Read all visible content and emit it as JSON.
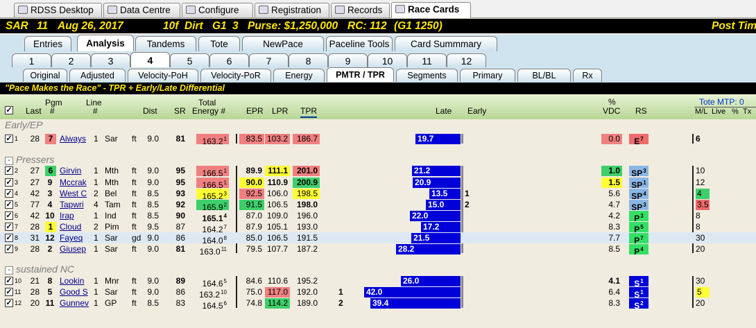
{
  "window_tabs": [
    {
      "label": "RDSS Desktop",
      "icon": "horse-icon"
    },
    {
      "label": "Data Centre",
      "icon": "table-icon"
    },
    {
      "label": "Configure",
      "icon": "gear-icon"
    },
    {
      "label": "Registration",
      "icon": "tools-icon"
    },
    {
      "label": "Records",
      "icon": "grid-icon"
    },
    {
      "label": "Race Cards",
      "icon": "document-icon",
      "active": true
    }
  ],
  "race_header": {
    "track": "SAR",
    "race": "11",
    "date": "Aug 26, 2017",
    "distance": "10f",
    "surface": "Dirt",
    "grade": "G1",
    "field": "3",
    "purse": "Purse: $1,250,000",
    "rc": "RC: 112",
    "rc_grade": "(G1 1250)",
    "post_time": "Post Tim"
  },
  "main_tabs": [
    "Entries",
    "Analysis",
    "Tandems",
    "Tote",
    "NewPace",
    "Paceline Tools",
    "Card Summmary"
  ],
  "main_tabs_active": 1,
  "race_tabs": [
    "1",
    "2",
    "3",
    "4",
    "5",
    "6",
    "7",
    "8",
    "9",
    "10",
    "11",
    "12"
  ],
  "race_tabs_active": 3,
  "sub_tabs": [
    "Original",
    "Adjusted",
    "Velocity-PoH",
    "Velocity-PoR",
    "Energy",
    "PMTR / TPR",
    "Segments",
    "Primary",
    "BL/BL",
    "Rx"
  ],
  "sub_tabs_active": 5,
  "banner": "\"Pace Makes the Race\" - TPR + Early/Late Differential",
  "columns": {
    "last": "Last",
    "pgm": "Pgm",
    "pgm2": "#",
    "line": "Line",
    "line2": "#",
    "dist": "Dist",
    "sr": "SR",
    "total": "Total",
    "energy": "Energy #",
    "epr": "EPR",
    "lpr": "LPR",
    "tpr": "TPR",
    "late": "Late",
    "early": "Early",
    "pct": "%",
    "vdc": "VDC",
    "rs": "RS",
    "tote": "Tote MTP: 0",
    "ml": "M/L",
    "live": "Live",
    "pct2": "%",
    "tx": "Tx"
  },
  "groups": [
    {
      "label": "Early/EP",
      "collapsible": false
    },
    {
      "label": "Pressers",
      "collapsible": true
    },
    {
      "label": "sustained NC",
      "collapsible": true
    }
  ],
  "rows": [
    {
      "idx": "1",
      "last": "28",
      "pgm": "7",
      "name": "Always",
      "line": "1",
      "trk": "Sar",
      "sfc": "ft",
      "dist": "9.0",
      "sr": "81",
      "energy": "163.2",
      "erank": "1",
      "epr": "83.5",
      "lpr": "103.2",
      "tpr": "186.7",
      "late": "19.7",
      "early": "",
      "vdc": "0.0",
      "rs": "E",
      "rsn": "7",
      "ml": "6",
      "mlbold": true
    },
    {
      "idx": "2",
      "last": "27",
      "pgm": "6",
      "name": "Girvin",
      "line": "1",
      "trk": "Mth",
      "sfc": "ft",
      "dist": "9.0",
      "sr": "95",
      "energy": "166.5",
      "erank": "1",
      "epr": "89.9",
      "lpr": "111.1",
      "tpr": "201.0",
      "late": "21.2",
      "early": "",
      "vdc": "1.0",
      "rs": "SP",
      "rsn": "3",
      "ml": "10"
    },
    {
      "idx": "3",
      "last": "27",
      "pgm": "9",
      "name": "Mccrak",
      "line": "1",
      "trk": "Mth",
      "sfc": "ft",
      "dist": "9.0",
      "sr": "95",
      "energy": "166.5",
      "erank": "1",
      "epr": "90.0",
      "lpr": "110.9",
      "tpr": "200.9",
      "late": "20.9",
      "early": "",
      "vdc": "1.5",
      "rs": "SP",
      "rsn": "1",
      "ml": "12"
    },
    {
      "idx": "4",
      "last": "42",
      "pgm": "3",
      "name": "West C",
      "line": "2",
      "trk": "Bel",
      "sfc": "ft",
      "dist": "8.5",
      "sr": "93",
      "energy": "165.2",
      "erank": "3",
      "epr": "92.5",
      "lpr": "106.0",
      "tpr": "198.5",
      "late": "13.5",
      "early": "1",
      "vdc": "5.6",
      "rs": "SP",
      "rsn": "4",
      "ml": "4"
    },
    {
      "idx": "5",
      "last": "77",
      "pgm": "4",
      "name": "Tapwri",
      "line": "4",
      "trk": "Tam",
      "sfc": "ft",
      "dist": "8.5",
      "sr": "92",
      "energy": "165.9",
      "erank": "2",
      "epr": "91.5",
      "lpr": "106.5",
      "tpr": "198.0",
      "late": "15.0",
      "early": "2",
      "vdc": "4.7",
      "rs": "SP",
      "rsn": "3",
      "ml": "3.5"
    },
    {
      "idx": "6",
      "last": "42",
      "pgm": "10",
      "name": "Irap",
      "line": "1",
      "trk": "Ind",
      "sfc": "ft",
      "dist": "8.5",
      "sr": "90",
      "energy": "165.1",
      "erank": "4",
      "epr": "87.0",
      "lpr": "109.0",
      "tpr": "196.0",
      "late": "22.0",
      "early": "",
      "vdc": "4.2",
      "rs": "P",
      "rsn": "3",
      "ml": "8"
    },
    {
      "idx": "7",
      "last": "28",
      "pgm": "1",
      "name": "Cloud",
      "line": "2",
      "trk": "Pim",
      "sfc": "ft",
      "dist": "9.5",
      "sr": "87",
      "energy": "164.2",
      "erank": "7",
      "epr": "87.9",
      "lpr": "105.1",
      "tpr": "193.0",
      "late": "17.2",
      "early": "",
      "vdc": "8.3",
      "rs": "P",
      "rsn": "5",
      "ml": "8"
    },
    {
      "idx": "8",
      "last": "31",
      "pgm": "12",
      "name": "Fayeq",
      "line": "1",
      "trk": "Sar",
      "sfc": "gd",
      "dist": "9.0",
      "sr": "86",
      "energy": "164.0",
      "erank": "8",
      "epr": "85.0",
      "lpr": "106.5",
      "tpr": "191.5",
      "late": "21.5",
      "early": "",
      "vdc": "7.7",
      "rs": "P",
      "rsn": "7",
      "ml": "30"
    },
    {
      "idx": "9",
      "last": "28",
      "pgm": "2",
      "name": "Giusep",
      "line": "1",
      "trk": "Sar",
      "sfc": "ft",
      "dist": "9.0",
      "sr": "81",
      "energy": "163.0",
      "erank": "11",
      "epr": "79.5",
      "lpr": "107.7",
      "tpr": "187.2",
      "late": "28.2",
      "early": "",
      "vdc": "8.5",
      "rs": "P",
      "rsn": "4",
      "ml": "20"
    },
    {
      "idx": "10",
      "last": "21",
      "pgm": "8",
      "name": "Lookin",
      "line": "1",
      "trk": "Mnr",
      "sfc": "ft",
      "dist": "9.0",
      "sr": "89",
      "energy": "164.6",
      "erank": "5",
      "epr": "84.6",
      "lpr": "110.6",
      "tpr": "195.2",
      "late": "26.0",
      "early": "",
      "vdc": "4.1",
      "vdcbold": true,
      "rs": "S",
      "rsn": "1",
      "ml": "30"
    },
    {
      "idx": "11",
      "last": "28",
      "pgm": "5",
      "name": "Good S",
      "line": "1",
      "trk": "Sar",
      "sfc": "ft",
      "dist": "9.0",
      "sr": "86",
      "energy": "163.2",
      "erank": "10",
      "epr": "75.0",
      "lpr": "117.0",
      "tpr": "192.0",
      "late": "42.0",
      "early": "1",
      "earlyleft": true,
      "vdc": "6.4",
      "rs": "S",
      "rsn": "1",
      "ml": "5"
    },
    {
      "idx": "12",
      "last": "20",
      "pgm": "11",
      "name": "Gunnev",
      "line": "1",
      "trk": "GP",
      "sfc": "ft",
      "dist": "8.5",
      "sr": "83",
      "energy": "164.5",
      "erank": "6",
      "epr": "74.8",
      "lpr": "114.2",
      "tpr": "189.0",
      "late": "39.4",
      "early": "2",
      "earlyleft": true,
      "vdc": "8.3",
      "rs": "S",
      "rsn": "2",
      "ml": "20"
    }
  ],
  "colors": {
    "red": "#f08080",
    "green": "#3ecf6a",
    "yellow": "#ffff33",
    "blue": "#0000d8",
    "rs_blue": "#8ab6e6",
    "rs_green": "#33e066",
    "rs_red": "#f06b6b"
  }
}
